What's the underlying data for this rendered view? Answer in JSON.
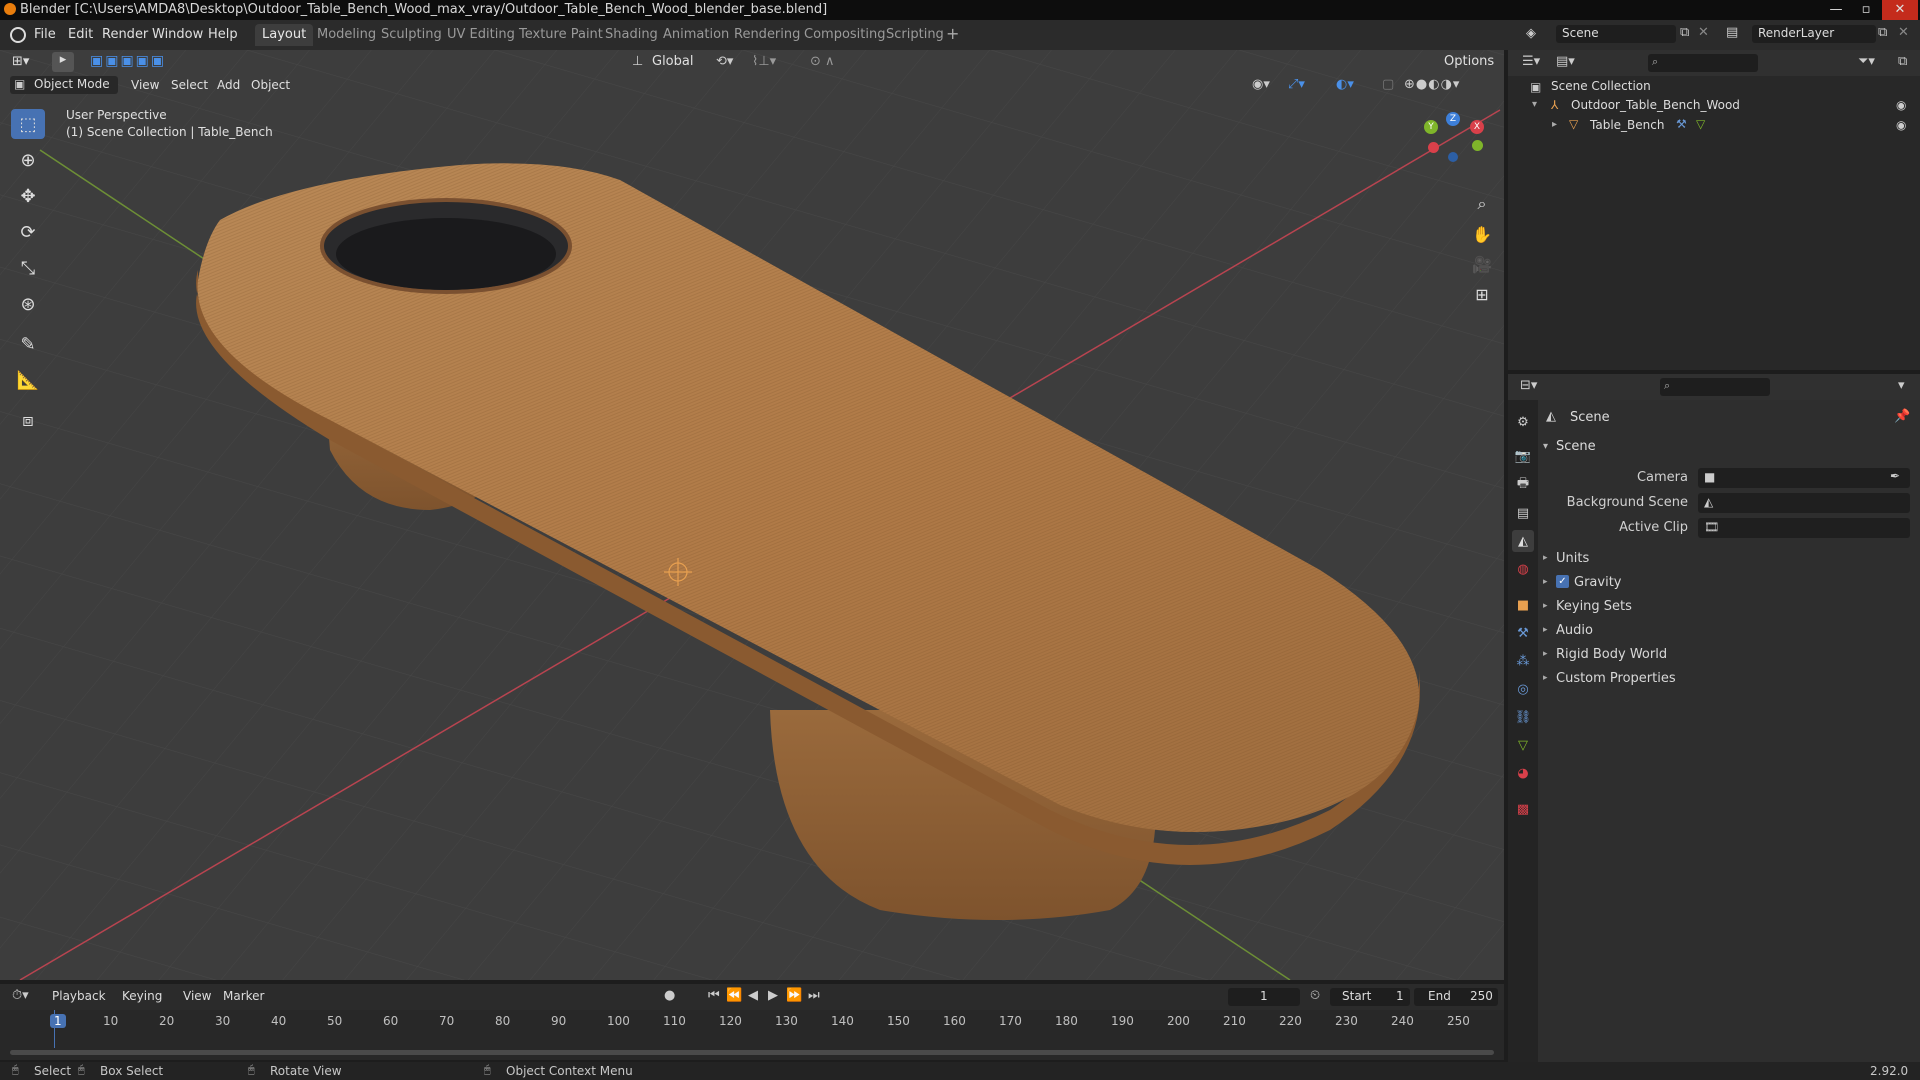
{
  "window": {
    "title": "Blender [C:\\Users\\AMDA8\\Desktop\\Outdoor_Table_Bench_Wood_max_vray/Outdoor_Table_Bench_Wood_blender_base.blend]"
  },
  "menu": [
    "File",
    "Edit",
    "Render",
    "Window",
    "Help"
  ],
  "workspaces": [
    "Layout",
    "Modeling",
    "Sculpting",
    "UV Editing",
    "Texture Paint",
    "Shading",
    "Animation",
    "Rendering",
    "Compositing",
    "Scripting"
  ],
  "active_workspace": "Layout",
  "scene_selector": {
    "scene": "Scene",
    "view_layer": "RenderLayer"
  },
  "viewport": {
    "transform_orientation": "Global",
    "options_label": "Options",
    "mode": "Object Mode",
    "menus": [
      "View",
      "Select",
      "Add",
      "Object"
    ],
    "overlay_line1": "User Perspective",
    "overlay_line2": "(1) Scene Collection | Table_Bench",
    "gizmo_axes": {
      "x": "X",
      "y": "Y",
      "z": "Z"
    }
  },
  "outliner": {
    "root": "Scene Collection",
    "items": [
      {
        "label": "Outdoor_Table_Bench_Wood",
        "level": 1
      },
      {
        "label": "Table_Bench",
        "level": 2
      }
    ]
  },
  "properties": {
    "context_title": "Scene",
    "panel_title": "Scene",
    "fields": [
      {
        "label": "Camera",
        "value": ""
      },
      {
        "label": "Background Scene",
        "value": ""
      },
      {
        "label": "Active Clip",
        "value": ""
      }
    ],
    "subpanels": [
      "Units",
      "Gravity",
      "Keying Sets",
      "Audio",
      "Rigid Body World",
      "Custom Properties"
    ],
    "gravity_checked": true
  },
  "timeline": {
    "menus": [
      "Playback",
      "Keying",
      "View",
      "Marker"
    ],
    "current_frame": "1",
    "start_label": "Start",
    "start_value": "1",
    "end_label": "End",
    "end_value": "250",
    "frame_ticks": [
      "1",
      "10",
      "20",
      "30",
      "40",
      "50",
      "60",
      "70",
      "80",
      "90",
      "100",
      "110",
      "120",
      "130",
      "140",
      "150",
      "160",
      "170",
      "180",
      "190",
      "200",
      "210",
      "220",
      "230",
      "240",
      "250"
    ]
  },
  "statusbar": {
    "select": "Select",
    "box_select": "Box Select",
    "rotate_view": "Rotate View",
    "context_menu": "Object Context Menu",
    "version": "2.92.0"
  },
  "colors": {
    "accent": "#4772b3",
    "viewport_bg": "#3d3d3d",
    "wood": "#b07a47",
    "x_axis": "#d9404a",
    "y_axis": "#7fb52a",
    "z_axis": "#3d7fd9"
  }
}
